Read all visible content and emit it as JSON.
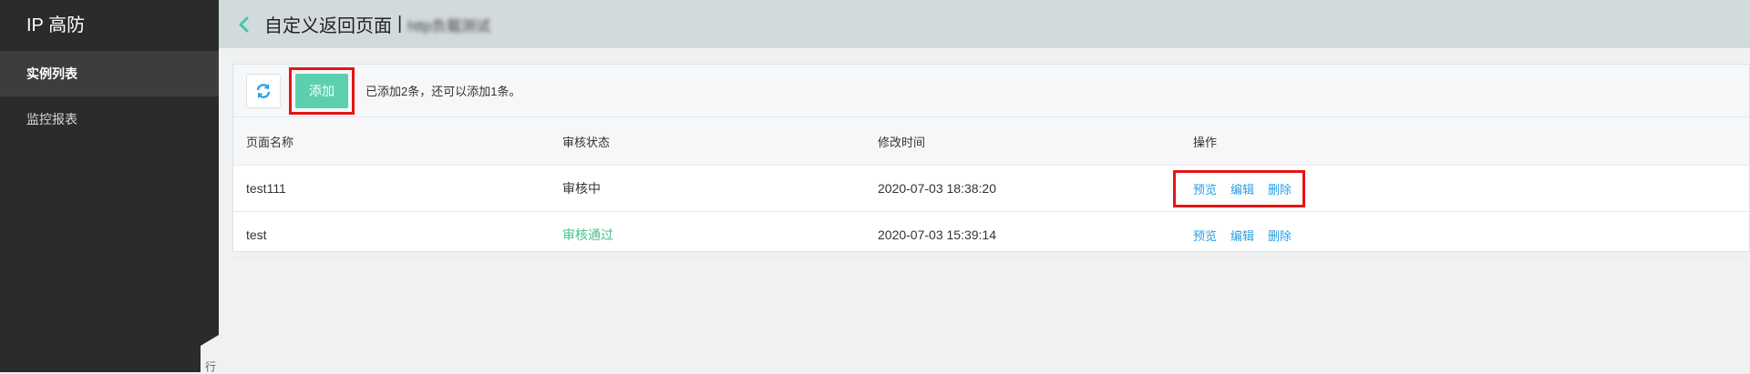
{
  "sidebar": {
    "brand": "IP 高防",
    "items": [
      {
        "label": "实例列表",
        "active": true
      },
      {
        "label": "监控报表",
        "active": false
      }
    ],
    "collapse_label": "行"
  },
  "header": {
    "back_icon": "chevron-left-icon",
    "title": "自定义返回页面",
    "separator": "|",
    "subtitle": "http负载测试"
  },
  "toolbar": {
    "refresh_icon": "refresh-icon",
    "add_label": "添加",
    "quota_text": "已添加2条，还可以添加1条。"
  },
  "table": {
    "columns": [
      "页面名称",
      "审核状态",
      "修改时间",
      "操作"
    ],
    "rows": [
      {
        "name": "test111",
        "status": "审核中",
        "modified": "2020-07-03 18:38:20",
        "ops": [
          "预览",
          "编辑",
          "删除"
        ]
      },
      {
        "name": "test",
        "status": "审核通过",
        "modified": "2020-07-03 15:39:14",
        "ops": [
          "预览",
          "编辑",
          "删除"
        ]
      }
    ]
  },
  "colors": {
    "sidebar_bg": "#2b2b2b",
    "accent_green": "#5ccfae",
    "status_ok": "#47c18c",
    "link_blue": "#2a9ee6",
    "highlight_red": "#e61414"
  }
}
